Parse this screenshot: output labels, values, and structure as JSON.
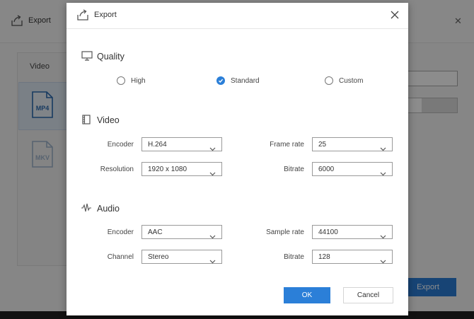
{
  "background_window": {
    "title": "Export",
    "panel_label": "Video",
    "formats": [
      "MP4",
      "MKV"
    ],
    "export_button": "Export"
  },
  "dialog": {
    "title": "Export",
    "quality": {
      "title": "Quality",
      "options": [
        {
          "label": "High",
          "selected": false
        },
        {
          "label": "Standard",
          "selected": true
        },
        {
          "label": "Custom",
          "selected": false
        }
      ]
    },
    "video": {
      "title": "Video",
      "encoder_label": "Encoder",
      "encoder_value": "H.264",
      "resolution_label": "Resolution",
      "resolution_value": "1920 x 1080",
      "frame_rate_label": "Frame rate",
      "frame_rate_value": "25",
      "bitrate_label": "Bitrate",
      "bitrate_value": "6000"
    },
    "audio": {
      "title": "Audio",
      "encoder_label": "Encoder",
      "encoder_value": "AAC",
      "channel_label": "Channel",
      "channel_value": "Stereo",
      "sample_rate_label": "Sample rate",
      "sample_rate_value": "44100",
      "bitrate_label": "Bitrate",
      "bitrate_value": "128"
    },
    "ok_label": "OK",
    "cancel_label": "Cancel"
  },
  "colors": {
    "accent": "#2b7fd8",
    "overlay": "#1d1d1d"
  },
  "icons": {
    "title": "export-icon",
    "close": "close-icon",
    "quality": "monitor-icon",
    "video": "film-icon",
    "audio": "waveform-icon",
    "dropdown": "chevron-down-icon"
  }
}
